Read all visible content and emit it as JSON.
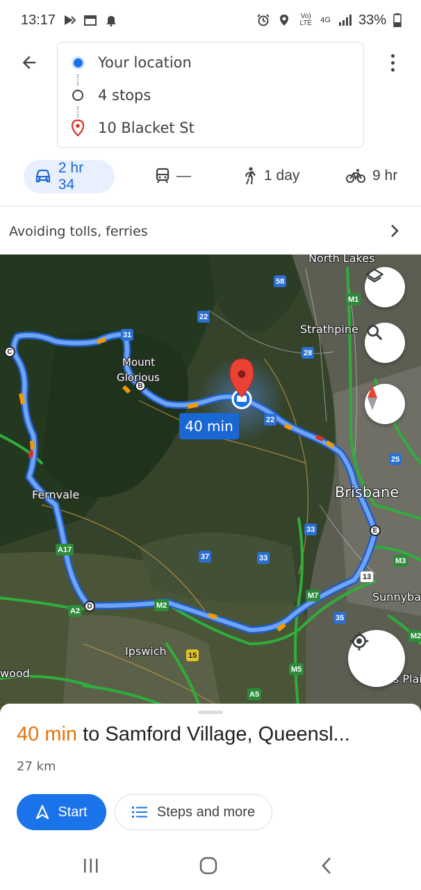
{
  "status_bar": {
    "time": "13:17",
    "network_label": "Vo) LTE",
    "network_type": "4G",
    "battery": "33%"
  },
  "directions": {
    "origin": "Your location",
    "stops": "4 stops",
    "destination": "10 Blacket St"
  },
  "modes": {
    "drive": "2 hr 34",
    "transit": "—",
    "walk": "1 day",
    "cycle": "9 hr"
  },
  "options": {
    "text": "Avoiding tolls, ferries"
  },
  "map": {
    "duration_tag": "40 min",
    "places": [
      "North Lakes",
      "Strathpine",
      "Mount",
      "Glorious",
      "Brisbane",
      "Fernvale",
      "Ipswich",
      "Sunnybank",
      "wood",
      "s Plai"
    ],
    "shields": [
      "58",
      "22",
      "31",
      "28",
      "M1",
      "22",
      "25",
      "33",
      "37",
      "33",
      "13",
      "M3",
      "M7",
      "35",
      "A17",
      "A2",
      "M2",
      "15",
      "M5",
      "A5",
      "M2"
    ],
    "stops": [
      "B",
      "C",
      "D",
      "E"
    ]
  },
  "sheet": {
    "duration": "40 min",
    "destination_text": "to Samford Village, Queensl...",
    "distance": "27 km",
    "start_label": "Start",
    "steps_label": "Steps and more"
  },
  "colors": {
    "accent": "#1a73e8",
    "duration_orange": "#e8710a",
    "route_blue": "#6fa3f5",
    "destination_red": "#ea4335"
  },
  "icons": {
    "back": "arrow-left-icon",
    "more": "more-vert-icon",
    "layers": "layers-icon",
    "search": "search-icon",
    "compass": "compass-icon",
    "locate": "my-location-icon"
  }
}
